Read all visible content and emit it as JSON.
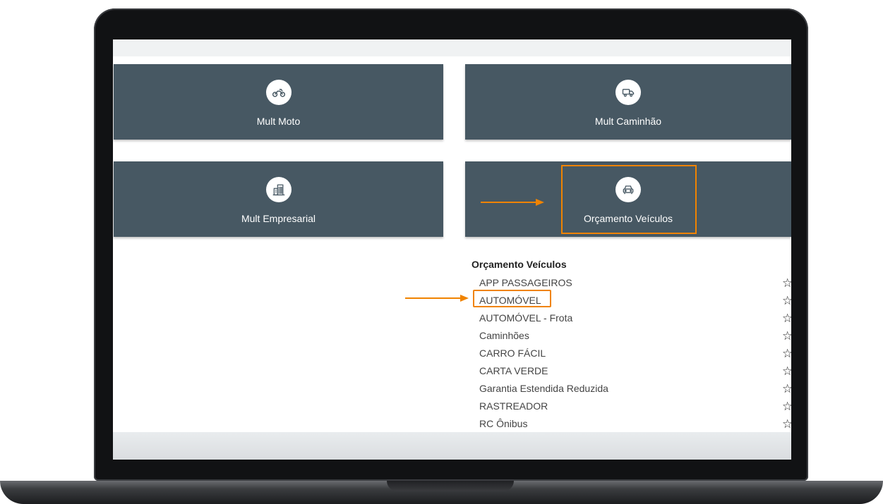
{
  "tiles": {
    "moto": {
      "label": "Mult Moto",
      "icon": "motorcycle-icon"
    },
    "caminhao": {
      "label": "Mult Caminhão",
      "icon": "truck-icon"
    },
    "empresarial": {
      "label": "Mult Empresarial",
      "icon": "building-icon"
    },
    "orcamento": {
      "label": "Orçamento Veículos",
      "icon": "car-icon"
    }
  },
  "list": {
    "title": "Orçamento Veículos",
    "items": [
      "APP PASSAGEIROS",
      "AUTOMÓVEL",
      "AUTOMÓVEL - Frota",
      "Caminhões",
      "CARRO FÁCIL",
      "CARTA VERDE",
      "Garantia Estendida Reduzida",
      "RASTREADOR",
      "RC Ônibus"
    ],
    "favorite_icon": "star-outline-icon",
    "favorite_glyph": "☆"
  },
  "colors": {
    "tile_bg": "#475863",
    "highlight": "#f08300",
    "tile_text": "#ffffff"
  }
}
